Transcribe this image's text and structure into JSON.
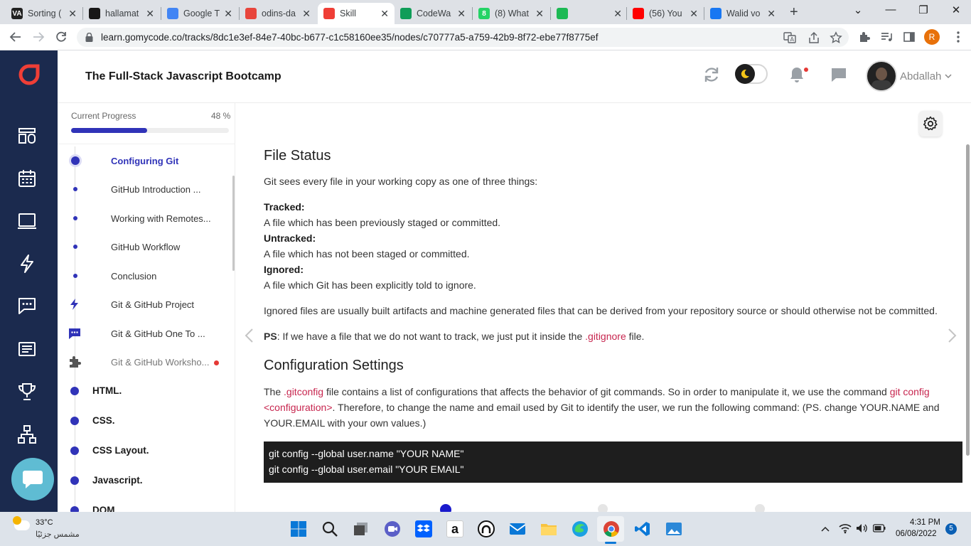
{
  "browser": {
    "tabs": [
      {
        "title": "Sorting (",
        "favicon_color": "#222",
        "favicon_text": "VA"
      },
      {
        "title": "hallamat",
        "favicon_color": "#181717",
        "favicon_text": ""
      },
      {
        "title": "Google T",
        "favicon_color": "#4285f4",
        "favicon_text": ""
      },
      {
        "title": "odins-da",
        "favicon_color": "#e8453c",
        "favicon_text": ""
      },
      {
        "title": "Skill",
        "favicon_color": "#ef3e36",
        "favicon_text": "",
        "active": true
      },
      {
        "title": "CodeWa",
        "favicon_color": "#0f9d58",
        "favicon_text": ""
      },
      {
        "title": "(8) What",
        "favicon_color": "#25d366",
        "favicon_text": "8"
      },
      {
        "title": "",
        "favicon_color": "#1db954",
        "favicon_text": ""
      },
      {
        "title": "(56) You",
        "favicon_color": "#ff0000",
        "favicon_text": ""
      },
      {
        "title": "Walid vo",
        "favicon_color": "#1877f2",
        "favicon_text": ""
      }
    ],
    "url": "learn.gomycode.co/tracks/8dc1e3ef-84e7-40bc-b677-c1c58160ee35/nodes/c70777a5-a759-42b9-8f72-ebe77f8775ef",
    "profile_initial": "R"
  },
  "header": {
    "course_title": "The Full-Stack Javascript Bootcamp",
    "username": "Abdallah"
  },
  "progress": {
    "label": "Current Progress",
    "percent_text": "48 %",
    "value": 0.48
  },
  "nodes": [
    {
      "label": "Configuring Git",
      "active": true
    },
    {
      "label": "GitHub Introduction ..."
    },
    {
      "label": "Working with Remotes..."
    },
    {
      "label": "GitHub Workflow"
    },
    {
      "label": "Conclusion"
    },
    {
      "label": "Git & GitHub Project",
      "icon": "bolt-icon"
    },
    {
      "label": "Git & GitHub One To ...",
      "icon": "chat-icon"
    },
    {
      "label": "Git & GitHub Worksho...",
      "icon": "puzzle-icon",
      "badge": true
    }
  ],
  "chapters": [
    "HTML.",
    "CSS.",
    "CSS Layout.",
    "Javascript.",
    "DOM"
  ],
  "article": {
    "h_file_status": "File Status",
    "intro": "Git sees every file in your working copy as one of three things:",
    "tracked_label": "Tracked:",
    "tracked_desc": "A file which has been previously staged or committed.",
    "untracked_label": "Untracked:",
    "untracked_desc": "A file which has not been staged or committed.",
    "ignored_label": "Ignored:",
    "ignored_desc": "A file which Git has been explicitly told to ignore.",
    "ignored_files": "Ignored files are usually built artifacts and machine generated files that can be derived from your repository source or should otherwise not be committed.",
    "ps_label": "PS",
    "ps_text_1": ": If we have a file that we do not want to track, we just put it inside the ",
    "ps_code": ".gitignore",
    "ps_text_2": " file.",
    "h_config": "Configuration Settings",
    "cfg_1": "The ",
    "cfg_code1": ".gitconfig",
    "cfg_2": " file contains a list of configurations that affects the behavior of git commands. So in order to manipulate it, we use the command ",
    "cfg_code2a": "git config",
    "cfg_code2b": "<configuration>",
    "cfg_3": ". Therefore, to change the name and email used by Git to identify the user, we run the following command: (PS. change YOUR.NAME and",
    "cfg_4": "YOUR.EMAIL with your own values.)",
    "code_line1": "git config --global user.name \"YOUR NAME\"",
    "code_line2": "git config --global user.email \"YOUR EMAIL\""
  },
  "taskbar": {
    "weather_temp": "33°C",
    "weather_desc": "مشمس جزئيًا",
    "time": "4:31 PM",
    "date": "06/08/2022",
    "notification_count": "5"
  },
  "colors": {
    "accent": "#3033b8",
    "sidebar": "#1b2a4e",
    "brand": "#ef3e36"
  }
}
